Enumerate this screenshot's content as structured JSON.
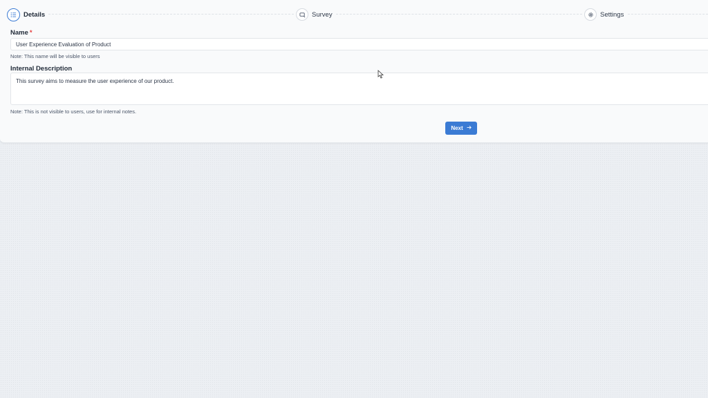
{
  "stepper": {
    "steps": [
      {
        "label": "Details",
        "icon": "list-icon",
        "active": true
      },
      {
        "label": "Survey",
        "icon": "survey-icon",
        "active": false
      },
      {
        "label": "Settings",
        "icon": "gear-icon",
        "active": false
      }
    ]
  },
  "form": {
    "name": {
      "label": "Name",
      "required_mark": "*",
      "value": "User Experience Evaluation of Product",
      "note": "Note: This name will be visible to users"
    },
    "description": {
      "label": "Internal Description",
      "value": "This survey aims to measure the user experience of our product.",
      "note": "Note: This is not visible to users, use for internal notes."
    }
  },
  "actions": {
    "next_label": "Next",
    "next_icon": "arrow-right-icon"
  },
  "colors": {
    "accent": "#3b7bd4",
    "required": "#e53e3e"
  }
}
